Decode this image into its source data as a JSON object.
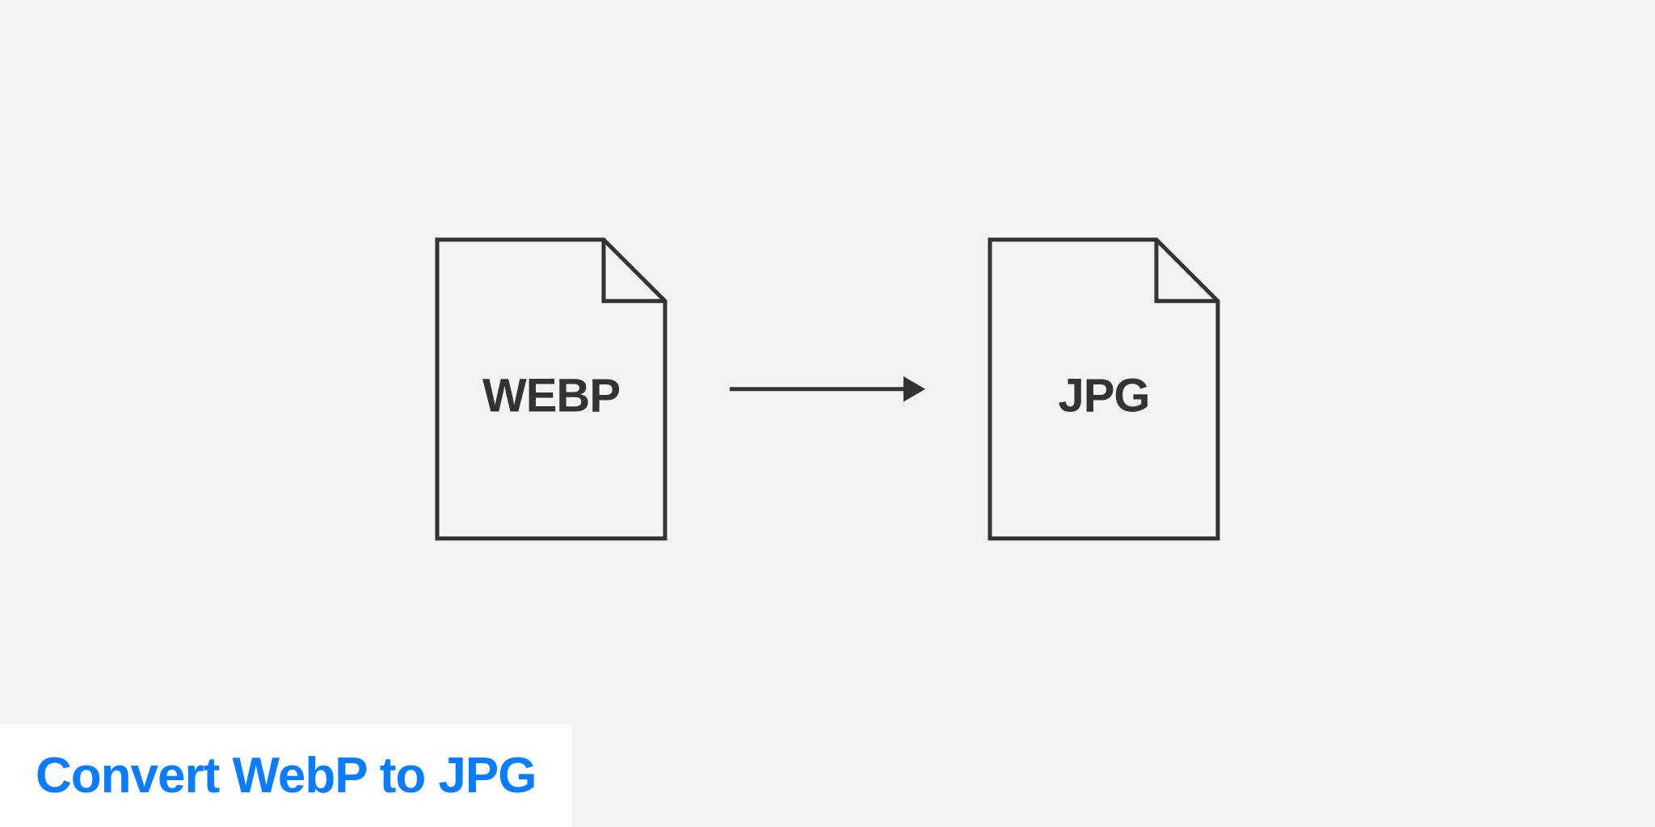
{
  "diagram": {
    "source_format": "WEBP",
    "target_format": "JPG"
  },
  "caption": "Convert WebP to JPG",
  "colors": {
    "background": "#f3f3f3",
    "stroke": "#333333",
    "accent": "#0a7cff",
    "caption_bg": "#ffffff"
  }
}
